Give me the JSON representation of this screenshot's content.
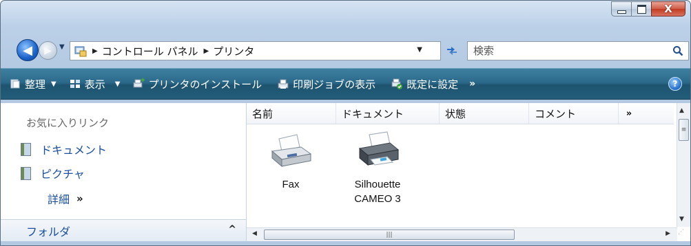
{
  "window": {
    "caption_minimize": "",
    "caption_maximize": "",
    "caption_close": "X"
  },
  "address": {
    "breadcrumbs": [
      "コントロール パネル",
      "プリンタ"
    ],
    "search_placeholder": "検索"
  },
  "toolbar": {
    "items": [
      {
        "label": "整理",
        "icon": "organize-icon",
        "has_dropdown": true
      },
      {
        "label": "表示",
        "icon": "views-icon",
        "has_dropdown": true
      },
      {
        "label": "プリンタのインストール",
        "icon": "add-printer-icon",
        "has_dropdown": false
      },
      {
        "label": "印刷ジョブの表示",
        "icon": "print-jobs-icon",
        "has_dropdown": false
      },
      {
        "label": "既定に設定",
        "icon": "set-default-icon",
        "has_dropdown": false
      }
    ],
    "more": "»",
    "help": "?"
  },
  "nav_pane": {
    "favorites_heading": "お気に入りリンク",
    "links": [
      {
        "label": "ドキュメント",
        "icon": "documents-icon"
      },
      {
        "label": "ピクチャ",
        "icon": "pictures-icon"
      }
    ],
    "more_label": "詳細",
    "more_chevron": "»",
    "folders_label": "フォルダ",
    "folders_chevron": "^"
  },
  "content": {
    "columns": [
      "名前",
      "ドキュメント",
      "状態",
      "コメント"
    ],
    "columns_more": "»",
    "items": [
      {
        "label": "Fax",
        "icon": "fax-icon"
      },
      {
        "label": "Silhouette CAMEO 3",
        "icon": "printer-icon"
      }
    ]
  },
  "colors": {
    "toolbar_gradient_top": "#3e7fa0",
    "toolbar_gradient_bottom": "#225d7a",
    "link_blue": "#1a4f9f"
  }
}
